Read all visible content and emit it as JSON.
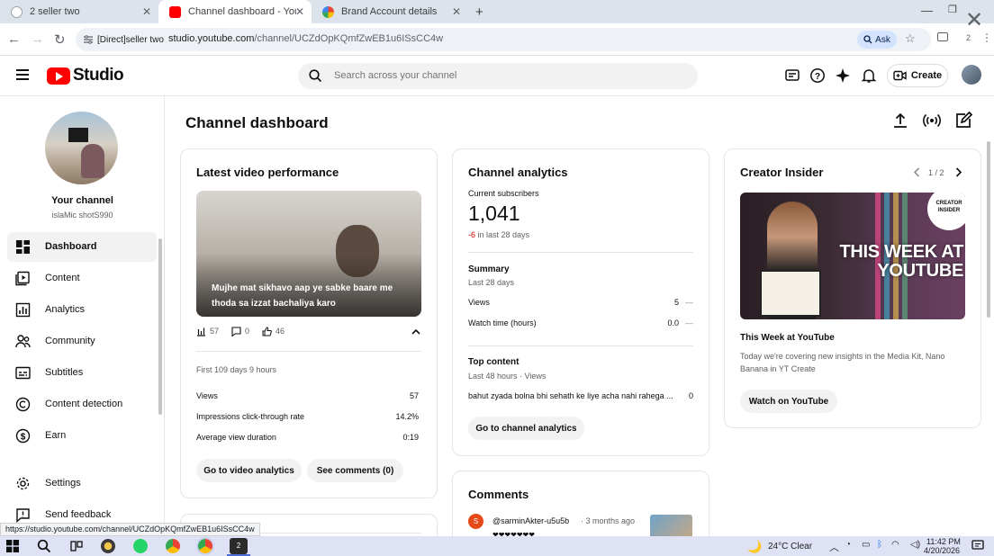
{
  "browser": {
    "tabs": [
      {
        "title": "2 seller two",
        "active": false
      },
      {
        "title": "Channel dashboard - YouTube",
        "active": true
      },
      {
        "title": "Brand Account details",
        "active": false
      }
    ],
    "new_tab": "+",
    "site_chip": "[Direct]seller two",
    "url_host": "studio.youtube.com",
    "url_path": "/channel/UCZdOpKQmfZwEB1u6ISsCC4w",
    "ask_label": "Ask",
    "profile_count": "2"
  },
  "header": {
    "logo_text": "Studio",
    "search_placeholder": "Search across your channel",
    "create_label": "Create"
  },
  "sidebar": {
    "channel_title": "Your channel",
    "channel_handle": "islaMic shotS990",
    "items": [
      {
        "label": "Dashboard",
        "icon": "dashboard-icon",
        "active": true
      },
      {
        "label": "Content",
        "icon": "content-icon"
      },
      {
        "label": "Analytics",
        "icon": "analytics-icon"
      },
      {
        "label": "Community",
        "icon": "community-icon"
      },
      {
        "label": "Subtitles",
        "icon": "subtitles-icon"
      },
      {
        "label": "Content detection",
        "icon": "copyright-icon"
      },
      {
        "label": "Earn",
        "icon": "earn-icon"
      },
      {
        "label": "Settings",
        "icon": "gear-icon"
      },
      {
        "label": "Send feedback",
        "icon": "feedback-icon"
      }
    ]
  },
  "main": {
    "page_title": "Channel dashboard",
    "latest": {
      "title": "Latest video performance",
      "video_caption": "Mujhe mat sikhavo aap ye sabke baare me thoda sa izzat bachaliya karo",
      "views_count": "57",
      "comments_count": "0",
      "likes_count": "46",
      "period": "First 109 days 9 hours",
      "rows": [
        {
          "label": "Views",
          "value": "57"
        },
        {
          "label": "Impressions click-through rate",
          "value": "14.2%"
        },
        {
          "label": "Average view duration",
          "value": "0:19"
        }
      ],
      "btn_analytics": "Go to video analytics",
      "btn_comments": "See comments (0)"
    },
    "analytics": {
      "title": "Channel analytics",
      "subs_label": "Current subscribers",
      "subs_value": "1,041",
      "subs_change": "-6",
      "subs_change_suffix": " in last 28 days",
      "summary_title": "Summary",
      "summary_period": "Last 28 days",
      "rows": [
        {
          "label": "Views",
          "value": "5",
          "trend": "—"
        },
        {
          "label": "Watch time (hours)",
          "value": "0.0",
          "trend": "—"
        }
      ],
      "top_title": "Top content",
      "top_period": "Last 48 hours · Views",
      "top_item": "bahut zyada bolna bhi sehath ke liye acha nahi rahega ...",
      "top_item_value": "0",
      "btn": "Go to channel analytics"
    },
    "insider": {
      "title": "Creator Insider",
      "pager": "1 / 2",
      "thumb_title": "THIS WEEK AT YOUTUBE",
      "badge": "CREATOR INSIDER",
      "video_title": "This Week at YouTube",
      "desc": "Today we're covering new insights in the Media Kit, Nano Banana in YT Create",
      "btn": "Watch on YouTube"
    },
    "comments": {
      "title": "Comments",
      "author": "@sarminAkter-u5u5b",
      "time": "· 3 months ago",
      "avatar_letter": "S",
      "snippet": "❤❤❤❤❤❤❤"
    }
  },
  "status_url": "https://studio.youtube.com/channel/UCZdOpKQmfZwEB1u6ISsCC4w",
  "taskbar": {
    "weather": "24°C  Clear",
    "time": "11:42 PM",
    "date": "4/20/2026",
    "chrome_badge": "2"
  },
  "colors": {
    "brand_red": "#ff0000",
    "negative": "#cc0000",
    "accent_blue": "#065fd4"
  }
}
